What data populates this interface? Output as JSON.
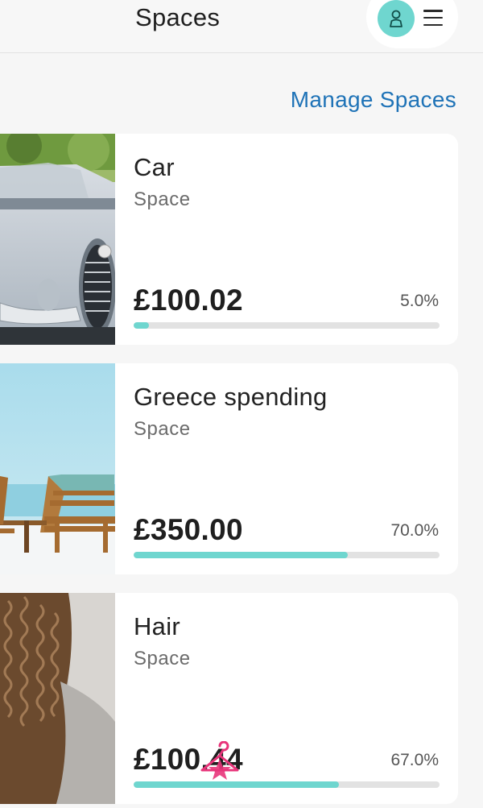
{
  "header": {
    "title": "Spaces",
    "avatar_icon": "user-icon",
    "menu_icon": "hamburger-menu-icon"
  },
  "manage_link": "Manage Spaces",
  "colors": {
    "accent": "#6fd6cf",
    "link": "#1f73b7",
    "track": "#e2e2e2"
  },
  "spaces": [
    {
      "name": "Car",
      "type": "Space",
      "amount": "£100.02",
      "percent_label": "5.0%",
      "progress": 0.05,
      "image": "classic-convertible-car-photo"
    },
    {
      "name": "Greece spending",
      "type": "Space",
      "amount": "£350.00",
      "percent_label": "70.0%",
      "progress": 0.7,
      "image": "beach-sun-loungers-photo"
    },
    {
      "name": "Hair",
      "type": "Space",
      "amount": "£100.44",
      "percent_label": "67.0%",
      "progress": 0.67,
      "image": "curly-hair-photo"
    }
  ]
}
